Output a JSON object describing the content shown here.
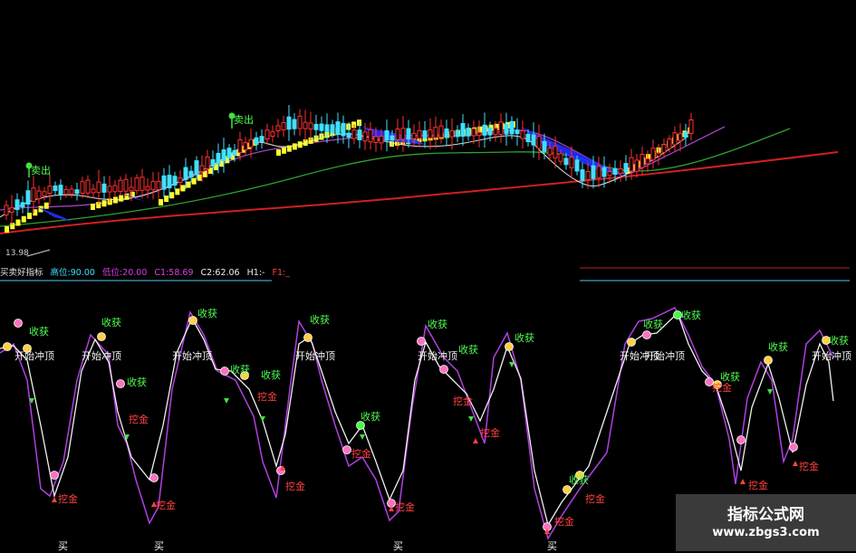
{
  "upper_panel": {
    "price_tag": "13.98",
    "sell_labels": [
      "卖出",
      "卖出"
    ]
  },
  "indicator_bar": {
    "name": "买卖好指标",
    "high": "高位:90.00",
    "low": "低位:20.00",
    "c1": "C1:58.69",
    "c2": "C2:62.06",
    "h1": "H1:-",
    "f1": "F1:_"
  },
  "signals": {
    "harvest": "收获",
    "start_top": "开始冲顶",
    "dig_gold": "挖金",
    "buy": "买"
  },
  "watermark": {
    "title": "指标公式网",
    "url": "www.zbgs3.com"
  },
  "colors": {
    "background": "#000000",
    "candle_up": "#ff3030",
    "candle_down": "#40e0ff",
    "ribbon_yellow": "#ffff30",
    "ribbon_blue": "#2030ff",
    "ma_red": "#d02020",
    "ma_green": "#30a030",
    "ma_purple": "#a040c0",
    "osc_white": "#f0f0f0",
    "osc_purple": "#b040e0",
    "label_green": "#50ff50",
    "label_red": "#ff4040"
  }
}
